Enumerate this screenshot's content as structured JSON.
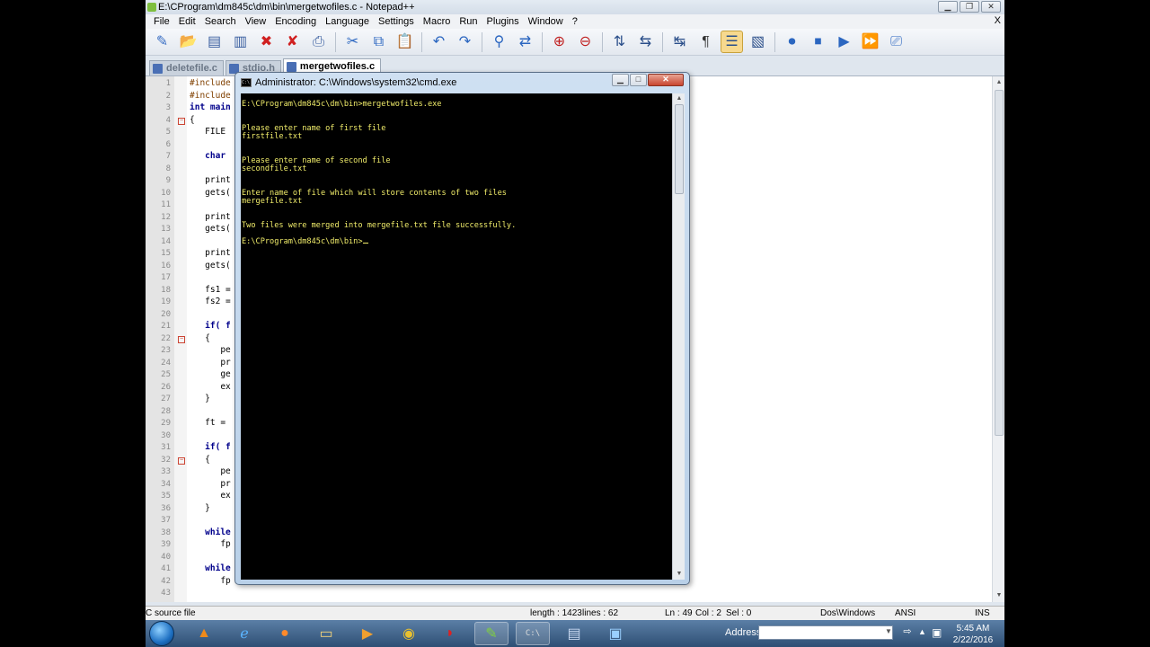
{
  "npp": {
    "title": "E:\\CProgram\\dm845c\\dm\\bin\\mergetwofiles.c - Notepad++",
    "menu": [
      "File",
      "Edit",
      "Search",
      "View",
      "Encoding",
      "Language",
      "Settings",
      "Macro",
      "Run",
      "Plugins",
      "Window",
      "?"
    ],
    "menu_close": "X",
    "tabs": [
      {
        "label": "deletefile.c",
        "active": false
      },
      {
        "label": "stdio.h",
        "active": false
      },
      {
        "label": "mergetwofiles.c",
        "active": true
      }
    ]
  },
  "editor": {
    "lines": [
      {
        "n": "1",
        "text": "#include"
      },
      {
        "n": "2",
        "text": "#include"
      },
      {
        "n": "3",
        "text": "int main"
      },
      {
        "n": "4",
        "text": "{"
      },
      {
        "n": "5",
        "text": "   FILE"
      },
      {
        "n": "6",
        "text": ""
      },
      {
        "n": "7",
        "text": "   char"
      },
      {
        "n": "8",
        "text": ""
      },
      {
        "n": "9",
        "text": "   print"
      },
      {
        "n": "10",
        "text": "   gets("
      },
      {
        "n": "11",
        "text": ""
      },
      {
        "n": "12",
        "text": "   print"
      },
      {
        "n": "13",
        "text": "   gets("
      },
      {
        "n": "14",
        "text": ""
      },
      {
        "n": "15",
        "text": "   print"
      },
      {
        "n": "16",
        "text": "   gets("
      },
      {
        "n": "17",
        "text": ""
      },
      {
        "n": "18",
        "text": "   fs1 ="
      },
      {
        "n": "19",
        "text": "   fs2 ="
      },
      {
        "n": "20",
        "text": ""
      },
      {
        "n": "21",
        "text": "   if( f"
      },
      {
        "n": "22",
        "text": "   {"
      },
      {
        "n": "23",
        "text": "      pe"
      },
      {
        "n": "24",
        "text": "      pr"
      },
      {
        "n": "25",
        "text": "      ge"
      },
      {
        "n": "26",
        "text": "      ex"
      },
      {
        "n": "27",
        "text": "   }"
      },
      {
        "n": "28",
        "text": ""
      },
      {
        "n": "29",
        "text": "   ft = "
      },
      {
        "n": "30",
        "text": ""
      },
      {
        "n": "31",
        "text": "   if( f"
      },
      {
        "n": "32",
        "text": "   {"
      },
      {
        "n": "33",
        "text": "      pe"
      },
      {
        "n": "34",
        "text": "      pr"
      },
      {
        "n": "35",
        "text": "      ex"
      },
      {
        "n": "36",
        "text": "   }"
      },
      {
        "n": "37",
        "text": ""
      },
      {
        "n": "38",
        "text": "   while"
      },
      {
        "n": "39",
        "text": "      fp"
      },
      {
        "n": "40",
        "text": ""
      },
      {
        "n": "41",
        "text": "   while"
      },
      {
        "n": "42",
        "text": "      fp"
      },
      {
        "n": "43",
        "text": ""
      }
    ]
  },
  "statusbar": {
    "filetype": "C source file",
    "length": "length : 1423",
    "lines": "lines : 62",
    "position": "Ln : 49",
    "col": "Col : 2",
    "sel": "Sel : 0",
    "eol": "Dos\\Windows",
    "encoding": "ANSI",
    "mode": "INS"
  },
  "cmd": {
    "title": "Administrator: C:\\Windows\\system32\\cmd.exe",
    "icon_text": "C:\\",
    "output": "E:\\CProgram\\dm845c\\dm\\bin>mergetwofiles.exe\n\n\nPlease enter name of first file\nfirstfile.txt\n\n\nPlease enter name of second file\nsecondfile.txt\n\n\nEnter name of file which will store contents of two files\nmergefile.txt\n\n\nTwo files were merged into mergefile.txt file successfully.\n\nE:\\CProgram\\dm845c\\dm\\bin>"
  },
  "taskbar": {
    "address_label": "Address",
    "address_value": "",
    "time": "5:45 AM",
    "date": "2/22/2016"
  },
  "icons": {
    "toolbar": [
      "new-file-icon",
      "open-file-icon",
      "save-icon",
      "save-all-icon",
      "close-icon",
      "close-all-icon",
      "print-icon",
      "cut-icon",
      "copy-icon",
      "paste-icon",
      "undo-icon",
      "redo-icon",
      "find-icon",
      "replace-icon",
      "zoom-in-icon",
      "zoom-out-icon",
      "sync-vertical-icon",
      "sync-horizontal-icon",
      "word-wrap-icon",
      "show-all-chars-icon",
      "indent-guide-icon",
      "doc-map-icon",
      "record-macro-icon",
      "stop-macro-icon",
      "play-macro-icon",
      "run-macro-multiple-icon",
      "save-macro-icon"
    ]
  }
}
